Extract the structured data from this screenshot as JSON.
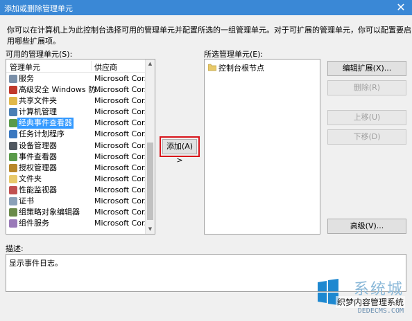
{
  "window": {
    "title": "添加或删除管理单元",
    "close_glyph": "✕"
  },
  "intro_text": "你可以在计算机上为此控制台选择可用的管理单元并配置所选的一组管理单元。对于可扩展的管理单元，你可以配置要启用哪些扩展项。",
  "available": {
    "label": "可用的管理单元(S):",
    "col_name": "管理单元",
    "col_vendor": "供应商",
    "items": [
      {
        "name": "服务",
        "vendor": "Microsoft Cor...",
        "icon": "services-icon"
      },
      {
        "name": "高级安全 Windows 防...",
        "vendor": "Microsoft Cor...",
        "icon": "firewall-icon"
      },
      {
        "name": "共享文件夹",
        "vendor": "Microsoft Cor...",
        "icon": "shared-folder-icon"
      },
      {
        "name": "计算机管理",
        "vendor": "Microsoft Cor...",
        "icon": "computer-management-icon"
      },
      {
        "name": "经典事件查看器",
        "vendor": "Microsoft Cor...",
        "icon": "event-viewer-icon",
        "selected": true
      },
      {
        "name": "任务计划程序",
        "vendor": "Microsoft Cor...",
        "icon": "clock-icon"
      },
      {
        "name": "设备管理器",
        "vendor": "Microsoft Cor...",
        "icon": "device-manager-icon"
      },
      {
        "name": "事件查看器",
        "vendor": "Microsoft Cor...",
        "icon": "event-viewer-icon"
      },
      {
        "name": "授权管理器",
        "vendor": "Microsoft Cor...",
        "icon": "authorization-icon"
      },
      {
        "name": "文件夹",
        "vendor": "Microsoft Cor...",
        "icon": "folder-icon"
      },
      {
        "name": "性能监视器",
        "vendor": "Microsoft Cor...",
        "icon": "performance-icon"
      },
      {
        "name": "证书",
        "vendor": "Microsoft Cor...",
        "icon": "certificate-icon"
      },
      {
        "name": "组策略对象编辑器",
        "vendor": "Microsoft Cor...",
        "icon": "group-policy-icon"
      },
      {
        "name": "组件服务",
        "vendor": "Microsoft Cor...",
        "icon": "component-services-icon"
      }
    ]
  },
  "add_button": "添加(A) >",
  "selected": {
    "label": "所选管理单元(E):",
    "root_node": "控制台根节点"
  },
  "buttons": {
    "edit_extensions": "编辑扩展(X)...",
    "remove": "删除(R)",
    "move_up": "上移(U)",
    "move_down": "下移(D)",
    "advanced": "高级(V)..."
  },
  "description": {
    "label": "描述:",
    "text": "显示事件日志。"
  },
  "watermark": {
    "brand": "系统城",
    "tagline": "织梦内容管理系统",
    "url": "DEDECMS.COM"
  },
  "colors": {
    "titlebar": "#3a88d6",
    "selection": "#3399ff",
    "highlight_border": "#d8131a"
  }
}
